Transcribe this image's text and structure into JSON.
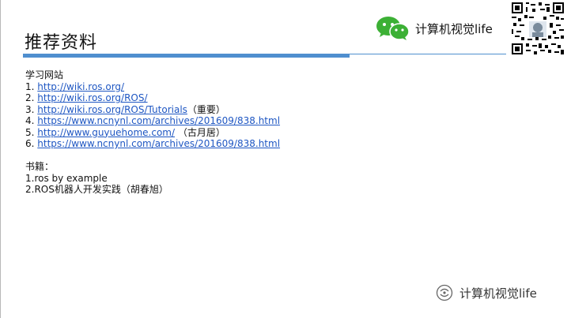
{
  "slide": {
    "title": "推荐资料",
    "brand": {
      "icon": "wechat-icon",
      "text": "计算机视觉life",
      "qr_icon": "qr-code-icon"
    },
    "section_websites": {
      "heading": "学习网站",
      "items": [
        {
          "num": "1.",
          "url": "http://wiki.ros.org/",
          "note": ""
        },
        {
          "num": "2.",
          "url": "http://wiki.ros.org/ROS/",
          "note": ""
        },
        {
          "num": "3.",
          "url": "http://wiki.ros.org/ROS/Tutorials",
          "note": "（重要）"
        },
        {
          "num": "4.",
          "url": "https://www.ncnynl.com/archives/201609/838.html",
          "note": ""
        },
        {
          "num": "5.",
          "url": "http://www.guyuehome.com/",
          "note": "（古月居）"
        },
        {
          "num": "6.",
          "url": "https://www.ncnynl.com/archives/201609/838.html",
          "note": ""
        }
      ]
    },
    "section_books": {
      "heading": "书籍：",
      "items": [
        "1.ros by example",
        "2.ROS机器人开发实践（胡春旭）"
      ]
    },
    "watermark": {
      "icon": "wechat-official-icon",
      "text": "计算机视觉life"
    }
  }
}
